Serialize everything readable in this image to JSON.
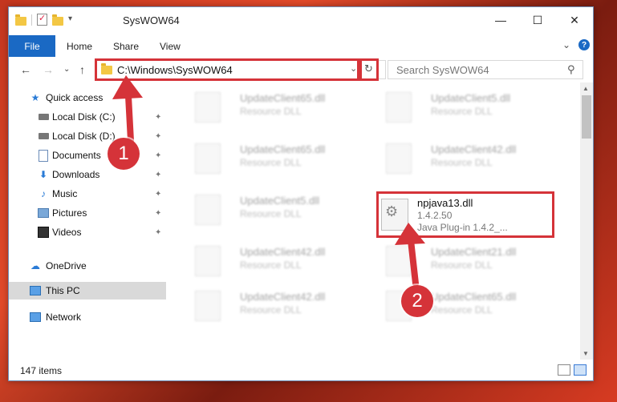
{
  "window": {
    "title": "SysWOW64",
    "controls": {
      "minimize": "—",
      "maximize": "☐",
      "close": "✕"
    }
  },
  "ribbon": {
    "tabs": [
      "File",
      "Home",
      "Share",
      "View"
    ],
    "expand": "⌄",
    "help": "?"
  },
  "nav": {
    "back": "←",
    "forward": "→",
    "up_list": "⌄",
    "up": "↑",
    "address": "C:\\Windows\\SysWOW64",
    "address_chevron": "⌄",
    "refresh": "↻",
    "search_placeholder": "Search SysWOW64",
    "search_icon": "⚲"
  },
  "sidebar": {
    "items": [
      {
        "label": "Quick access",
        "icon": "star-icon",
        "pinned": false
      },
      {
        "label": "Local Disk (C:)",
        "icon": "drive-icon",
        "pinned": true
      },
      {
        "label": "Local Disk (D:)",
        "icon": "drive-icon",
        "pinned": true
      },
      {
        "label": "Documents",
        "icon": "documents-icon",
        "pinned": true
      },
      {
        "label": "Downloads",
        "icon": "downloads-icon",
        "pinned": true
      },
      {
        "label": "Music",
        "icon": "music-icon",
        "pinned": true
      },
      {
        "label": "Pictures",
        "icon": "pictures-icon",
        "pinned": true
      },
      {
        "label": "Videos",
        "icon": "videos-icon",
        "pinned": true
      },
      {
        "label": "OneDrive",
        "icon": "onedrive-icon",
        "pinned": false
      },
      {
        "label": "This PC",
        "icon": "this-pc-icon",
        "pinned": false,
        "selected": true
      },
      {
        "label": "Network",
        "icon": "network-icon",
        "pinned": false
      }
    ],
    "pin_glyph": "📌"
  },
  "files": {
    "left_column": [
      {
        "name": "UpdateClient65.dll",
        "desc": "Resource DLL"
      },
      {
        "name": "UpdateClient65.dll",
        "desc": "Resource DLL"
      },
      {
        "name": "UpdateClient5.dll",
        "desc": "Resource DLL"
      },
      {
        "name": "UpdateClient42.dll",
        "desc": "Resource DLL"
      },
      {
        "name": "UpdateClient42.dll",
        "desc": "Resource DLL"
      }
    ],
    "right_column": [
      {
        "name": "UpdateClient5.dll",
        "desc": "Resource DLL"
      },
      {
        "name": "UpdateClient42.dll",
        "desc": "Resource DLL"
      },
      {
        "name": "UpdateClient21.dll",
        "desc": "Resource DLL"
      },
      {
        "name": "UpdateClient65.dll",
        "desc": "Resource DLL"
      }
    ],
    "target": {
      "name": "npjava13.dll",
      "version": "1.4.2.50",
      "description": "Java Plug-in 1.4.2_..."
    }
  },
  "status": {
    "items_count": "147 items"
  },
  "annotations": {
    "step1": "1",
    "step2": "2"
  },
  "colors": {
    "accent": "#1a69c4",
    "highlight": "#d53339",
    "selected": "#d9d9d9"
  }
}
